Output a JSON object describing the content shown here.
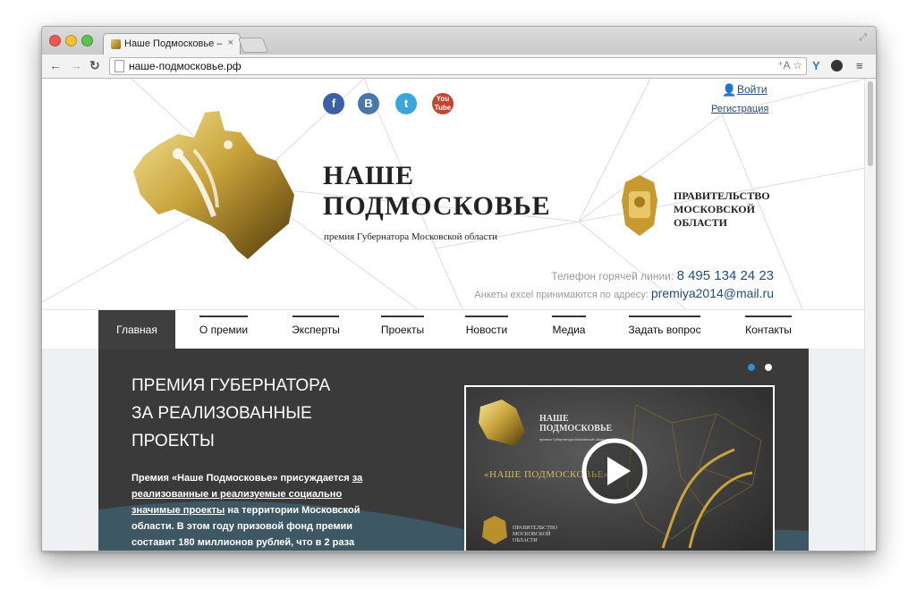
{
  "browser": {
    "tab_title": "Наше Подмосковье – прем",
    "tab_close": "×",
    "url": "наше-подмосковье.рф",
    "omni_right": "⁺A ☆",
    "colors": {
      "chrome": "#d4d4d4",
      "accent": "#1f4e7c"
    }
  },
  "header": {
    "social": [
      "f",
      "B",
      "t",
      "You Tube"
    ],
    "login": "Войти",
    "register": "Регистрация",
    "title_line1": "НАШЕ",
    "title_line2": "ПОДМОСКОВЬЕ",
    "subtitle": "премия Губернатора Московской области",
    "gov_line1": "ПРАВИТЕЛЬСТВО",
    "gov_line2": "МОСКОВСКОЙ",
    "gov_line3": "ОБЛАСТИ",
    "hotline_label": "Телефон горячей линии:",
    "hotline_value": "8 495 134 24 23",
    "email_label": "Анкеты excel принимаются по адресу:",
    "email_value": "premiya2014@mail.ru"
  },
  "nav": {
    "items": [
      {
        "label": "Главная"
      },
      {
        "label": "О премии"
      },
      {
        "label": "Эксперты"
      },
      {
        "label": "Проекты"
      },
      {
        "label": "Новости"
      },
      {
        "label": "Медиа"
      },
      {
        "label": "Задать вопрос"
      },
      {
        "label": "Контакты"
      }
    ]
  },
  "hero": {
    "title_line1": "ПРЕМИЯ ГУБЕРНАТОРА",
    "title_line2": "ЗА РЕАЛИЗОВАННЫЕ",
    "title_line3": "ПРОЕКТЫ",
    "text_part1": "Премия «Наше Подмосковье» присуждается ",
    "text_link": "за реализованные и реализуемые социально значимые проекты",
    "text_part2": " на территории Московской области. В этом году призовой фонд премии составит 180 миллионов рублей, что в 2 раза",
    "video": {
      "title_line1": "НАШЕ",
      "title_line2": "ПОДМОСКОВЬЕ",
      "subtitle": "премия Губернатора Московской области",
      "main": "«НАШЕ ПОДМОСКОВЬЕ»",
      "gov_line1": "ПРАВИТЕЛЬСТВО",
      "gov_line2": "МОСКОВСКОЙ",
      "gov_line3": "ОБЛАСТИ"
    }
  }
}
